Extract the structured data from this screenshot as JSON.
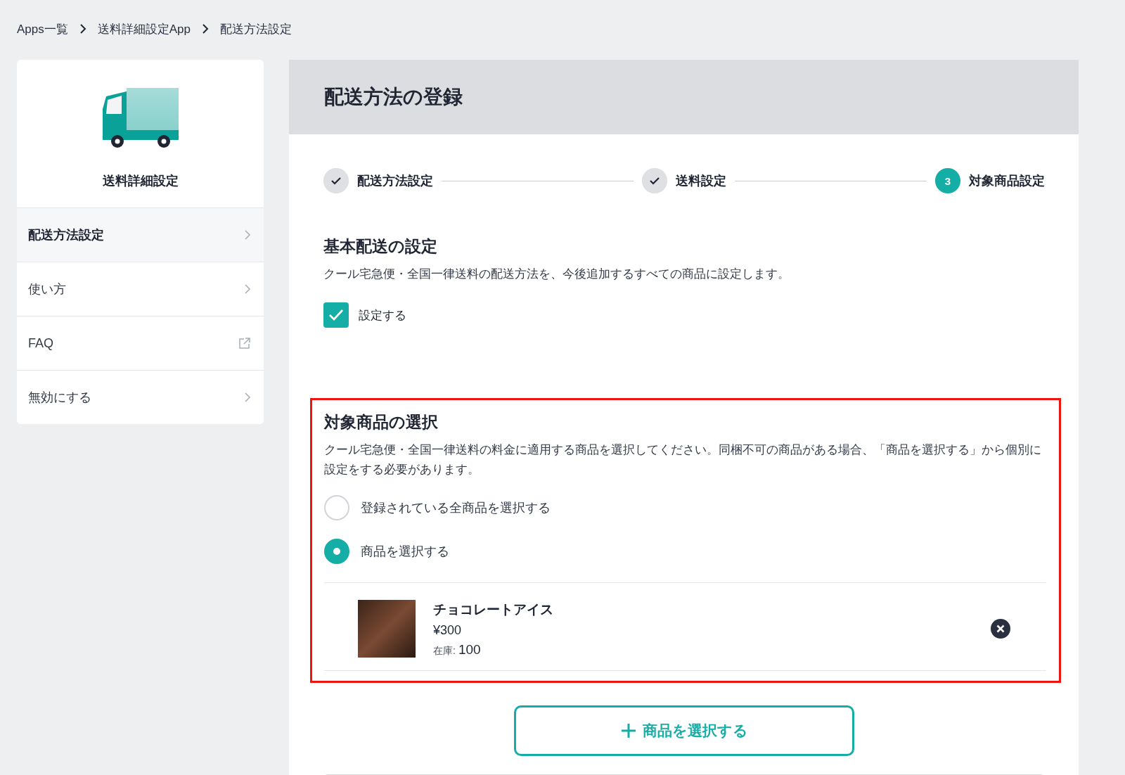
{
  "breadcrumb": [
    "Apps一覧",
    "送料詳細設定App",
    "配送方法設定"
  ],
  "sidebar": {
    "app_name": "送料詳細設定",
    "items": [
      {
        "label": "配送方法設定",
        "selected": true,
        "kind": "chevron"
      },
      {
        "label": "使い方",
        "selected": false,
        "kind": "chevron"
      },
      {
        "label": "FAQ",
        "selected": false,
        "kind": "external"
      },
      {
        "label": "無効にする",
        "selected": false,
        "kind": "chevron"
      }
    ]
  },
  "main": {
    "title": "配送方法の登録",
    "steps": [
      {
        "label": "配送方法設定",
        "done": true
      },
      {
        "label": "送料設定",
        "done": true
      },
      {
        "label": "対象商品設定",
        "done": false,
        "number": "3"
      }
    ],
    "basic": {
      "title": "基本配送の設定",
      "description": "クール宅急便・全国一律送料の配送方法を、今後追加するすべての商品に設定します。",
      "checkbox": {
        "label": "設定する",
        "checked": true
      }
    },
    "target": {
      "title": "対象商品の選択",
      "description": "クール宅急便・全国一律送料の料金に適用する商品を選択してください。同梱不可の商品がある場合、「商品を選択する」から個別に設定をする必要があります。",
      "options": [
        {
          "label": "登録されている全商品を選択する",
          "selected": false
        },
        {
          "label": "商品を選択する",
          "selected": true
        }
      ],
      "products": [
        {
          "name": "チョコレートアイス",
          "price": "¥300",
          "stock_label": "在庫:",
          "stock": "100"
        }
      ]
    },
    "add_button": "商品を選択する"
  }
}
